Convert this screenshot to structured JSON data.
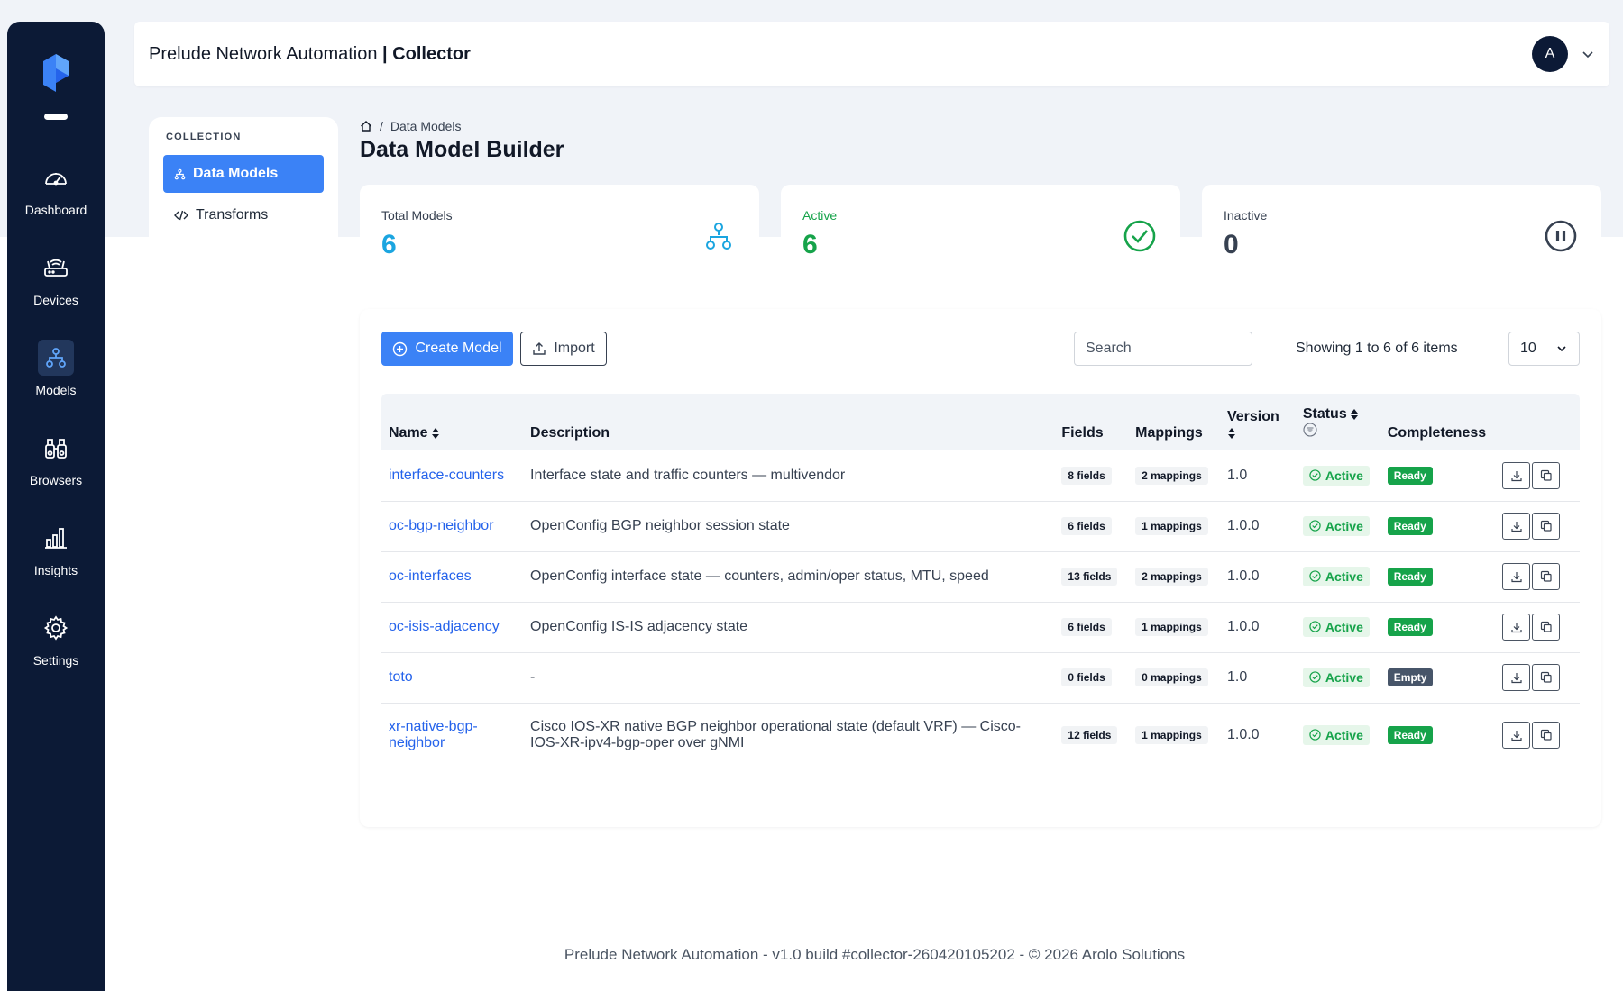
{
  "app": {
    "title_prefix": "Prelude Network Automation",
    "title_sep": " | ",
    "title_module": "Collector",
    "avatar_initial": "A"
  },
  "sidebar": {
    "items": [
      {
        "label": "Dashboard",
        "icon": "gauge-icon",
        "active": false
      },
      {
        "label": "Devices",
        "icon": "router-icon",
        "active": false
      },
      {
        "label": "Models",
        "icon": "hierarchy-icon",
        "active": true
      },
      {
        "label": "Browsers",
        "icon": "binoculars-icon",
        "active": false
      },
      {
        "label": "Insights",
        "icon": "bar-chart-icon",
        "active": false
      },
      {
        "label": "Settings",
        "icon": "gear-icon",
        "active": false
      }
    ]
  },
  "collection": {
    "title": "COLLECTION",
    "items": [
      {
        "label": "Data Models",
        "icon": "hierarchy-icon",
        "active": true
      },
      {
        "label": "Transforms",
        "icon": "code-icon",
        "active": false
      }
    ]
  },
  "breadcrumb": {
    "sep": "/",
    "current": "Data Models"
  },
  "page_title": "Data Model Builder",
  "stats": [
    {
      "label": "Total Models",
      "value": "6",
      "color": "#1ba5e0",
      "label_color": "#374151",
      "icon": "hierarchy-icon"
    },
    {
      "label": "Active",
      "value": "6",
      "color": "#16a34a",
      "label_color": "#16a34a",
      "icon": "check-circle-icon"
    },
    {
      "label": "Inactive",
      "value": "0",
      "color": "#374151",
      "label_color": "#374151",
      "icon": "pause-circle-icon"
    }
  ],
  "toolbar": {
    "create_label": "Create Model",
    "import_label": "Import",
    "search_placeholder": "Search",
    "showing": "Showing 1 to 6 of 6 items",
    "page_size": "10"
  },
  "table": {
    "headers": {
      "name": "Name",
      "description": "Description",
      "fields": "Fields",
      "mappings": "Mappings",
      "version": "Version",
      "status": "Status",
      "completeness": "Completeness"
    },
    "rows": [
      {
        "name": "interface-counters",
        "description": "Interface state and traffic counters — multivendor",
        "fields": "8 fields",
        "mappings": "2 mappings",
        "version": "1.0",
        "status": "Active",
        "completeness": "Ready"
      },
      {
        "name": "oc-bgp-neighbor",
        "description": "OpenConfig BGP neighbor session state",
        "fields": "6 fields",
        "mappings": "1 mappings",
        "version": "1.0.0",
        "status": "Active",
        "completeness": "Ready"
      },
      {
        "name": "oc-interfaces",
        "description": "OpenConfig interface state — counters, admin/oper status, MTU, speed",
        "fields": "13 fields",
        "mappings": "2 mappings",
        "version": "1.0.0",
        "status": "Active",
        "completeness": "Ready"
      },
      {
        "name": "oc-isis-adjacency",
        "description": "OpenConfig IS-IS adjacency state",
        "fields": "6 fields",
        "mappings": "1 mappings",
        "version": "1.0.0",
        "status": "Active",
        "completeness": "Ready"
      },
      {
        "name": "toto",
        "description": "-",
        "fields": "0 fields",
        "mappings": "0 mappings",
        "version": "1.0",
        "status": "Active",
        "completeness": "Empty"
      },
      {
        "name": "xr-native-bgp-neighbor",
        "description": "Cisco IOS-XR native BGP neighbor operational state (default VRF) — Cisco-IOS-XR-ipv4-bgp-oper over gNMI",
        "fields": "12 fields",
        "mappings": "1 mappings",
        "version": "1.0.0",
        "status": "Active",
        "completeness": "Ready"
      }
    ]
  },
  "footer": "Prelude Network Automation - v1.0 build #collector-260420105202 - © 2026 Arolo Solutions"
}
